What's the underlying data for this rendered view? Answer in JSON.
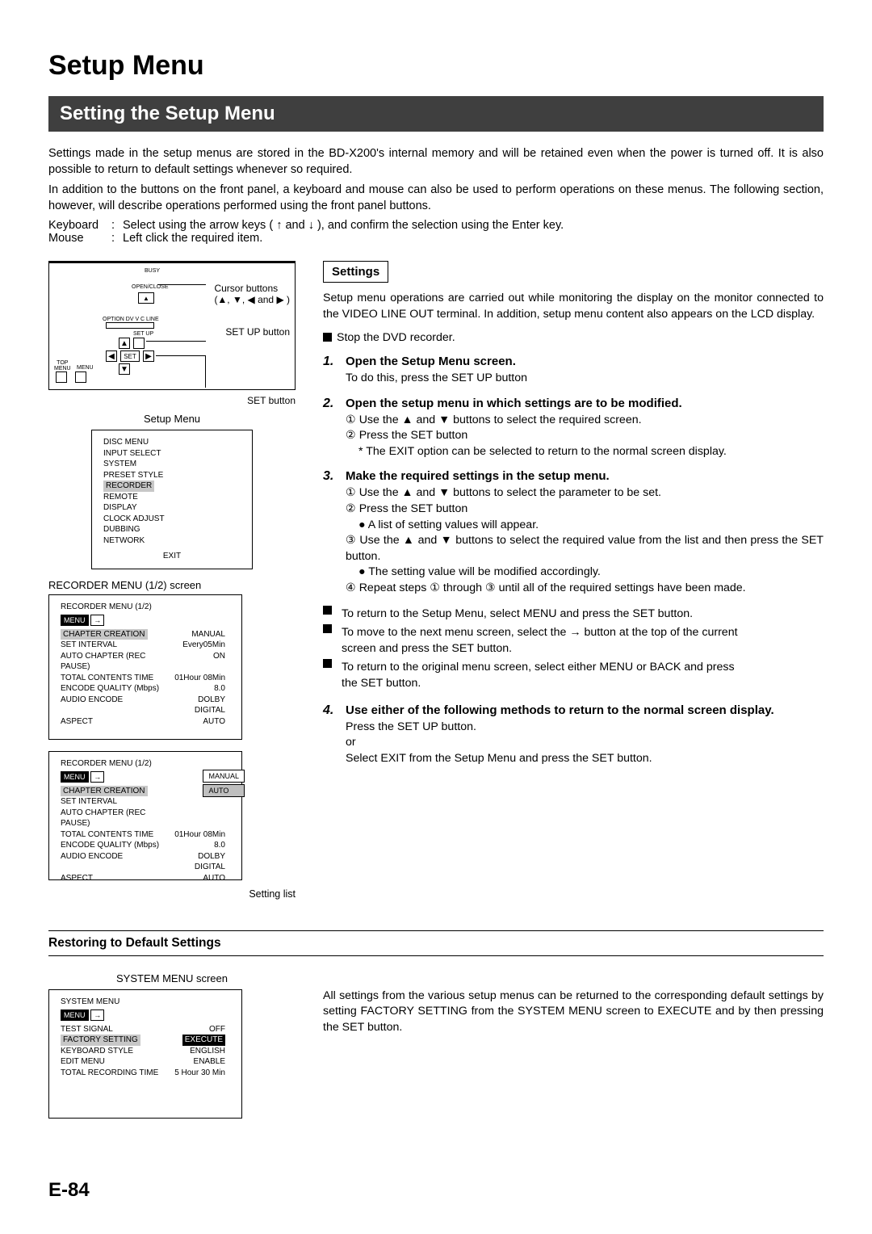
{
  "title": "Setup Menu",
  "sectionBar": "Setting the Setup Menu",
  "intro1": "Settings made in the setup menus are stored in the BD-X200's internal memory and will be retained even when the power is turned off. It is also possible to return to default settings whenever so required.",
  "intro2": "In addition to the buttons on the front panel, a keyboard and mouse can also be used to perform operations on these menus. The following section, however, will describe operations performed using the front panel buttons.",
  "kbLabel": "Keyboard",
  "kbText": "Select using the arrow keys ( ↑ and ↓ ), and confirm the selection using the Enter key.",
  "msLabel": "Mouse",
  "msText": "Left click the required item.",
  "diagram": {
    "cursor": "Cursor buttons",
    "cursorKeys": "(▲, ▼, ◀ and ▶ )",
    "setup": "SET UP button",
    "set": "SET button",
    "openClose": "OPEN/CLOSE",
    "busy": "BUSY",
    "optionLine": "OPTION   DV   V C   LINE",
    "setupTxt": "SET UP",
    "setTxt": "SET",
    "topMenu": "TOP\nMENU",
    "menu": "MENU"
  },
  "setupMenuCaption": "Setup Menu",
  "setupMenuItems": [
    "DISC MENU",
    "INPUT SELECT",
    "SYSTEM",
    "PRESET STYLE",
    "RECORDER",
    "REMOTE",
    "DISPLAY",
    "CLOCK ADJUST",
    "DUBBING",
    "NETWORK"
  ],
  "setupMenuExit": "EXIT",
  "recCaption": "RECORDER MENU (1/2) screen",
  "recMenuTitle": "RECORDER MENU (1/2)",
  "recMenuBtn": "MENU",
  "recRows": [
    {
      "k": "CHAPTER CREATION",
      "v": "MANUAL",
      "hl": true
    },
    {
      "k": "SET INTERVAL",
      "v": "Every05Min"
    },
    {
      "k": "AUTO CHAPTER (REC PAUSE)",
      "v": "ON"
    },
    {
      "k": "TOTAL CONTENTS TIME",
      "v": "01Hour 08Min"
    },
    {
      "k": "ENCODE QUALITY (Mbps)",
      "v": "8.0"
    },
    {
      "k": "AUDIO ENCODE",
      "v": "DOLBY DIGITAL"
    },
    {
      "k": "ASPECT",
      "v": "AUTO"
    }
  ],
  "recRows2": [
    {
      "k": "CHAPTER CREATION",
      "v": "",
      "hl": true
    },
    {
      "k": "SET INTERVAL",
      "v": ""
    },
    {
      "k": "AUTO CHAPTER (REC PAUSE)",
      "v": ""
    },
    {
      "k": "TOTAL CONTENTS TIME",
      "v": "01Hour 08Min"
    },
    {
      "k": "ENCODE QUALITY (Mbps)",
      "v": "8.0"
    },
    {
      "k": "AUDIO ENCODE",
      "v": "DOLBY DIGITAL"
    },
    {
      "k": "ASPECT",
      "v": "AUTO"
    }
  ],
  "sideOpts": [
    "MANUAL",
    "AUTO"
  ],
  "settingList": "Setting list",
  "settingsHeading": "Settings",
  "settingsPara": "Setup menu operations are carried out while monitoring the display on the monitor connected to the VIDEO LINE OUT terminal. In addition, setup menu content also appears on the LCD display.",
  "stopDvd": "Stop the DVD recorder.",
  "step1t": "Open the Setup Menu screen.",
  "step1b": "To do this, press the SET UP button",
  "step2t": "Open the setup menu in which settings are to be modified.",
  "step2_1": "Use the ▲ and ▼ buttons to select the required screen.",
  "step2_2": "Press the SET button",
  "step2_star": "The EXIT option can be selected to return to the normal screen display.",
  "step3t": "Make the required settings in the setup menu.",
  "step3_1": "Use the ▲ and ▼ buttons to select the parameter to be set.",
  "step3_2": "Press the SET button",
  "step3_2b": "A list of setting values will appear.",
  "step3_3": "Use the ▲ and ▼ buttons to select the required value from the list and then press the SET button.",
  "step3_3b": "The setting value will be modified accordingly.",
  "step3_4": "Repeat steps ① through ③ until all of the required settings have been made.",
  "sq1": "To return to the Setup Menu, select MENU and press the SET button.",
  "sq2a": "To move to the next menu screen, select the → button at the top of the current",
  "sq2b": "screen and press the SET button.",
  "sq3a": "To return to the original menu screen, select either MENU or BACK and press",
  "sq3b": "the SET button.",
  "step4t": "Use either of the following methods to return to the normal screen display.",
  "step4_1": "Press the SET UP button.",
  "step4_or": "or",
  "step4_2": "Select EXIT from the Setup Menu and press the SET button.",
  "restoringHeading": "Restoring to Default Settings",
  "sysCaption": "SYSTEM MENU screen",
  "sysMenuTitle": "SYSTEM MENU",
  "sysRows": [
    {
      "k": "TEST SIGNAL",
      "v": "OFF"
    },
    {
      "k": "FACTORY SETTING",
      "v": "EXECUTE",
      "hl": true,
      "vinv": true
    },
    {
      "k": "KEYBOARD STYLE",
      "v": "ENGLISH"
    },
    {
      "k": "EDIT MENU",
      "v": "ENABLE"
    },
    {
      "k": "TOTAL RECORDING TIME",
      "v": "5 Hour 30 Min"
    }
  ],
  "restoringPara": "All settings from the various setup menus can be returned to the corresponding default settings by setting FACTORY SETTING from the SYSTEM MENU screen to EXECUTE and by then pressing the SET button.",
  "pageNum": "E-84"
}
